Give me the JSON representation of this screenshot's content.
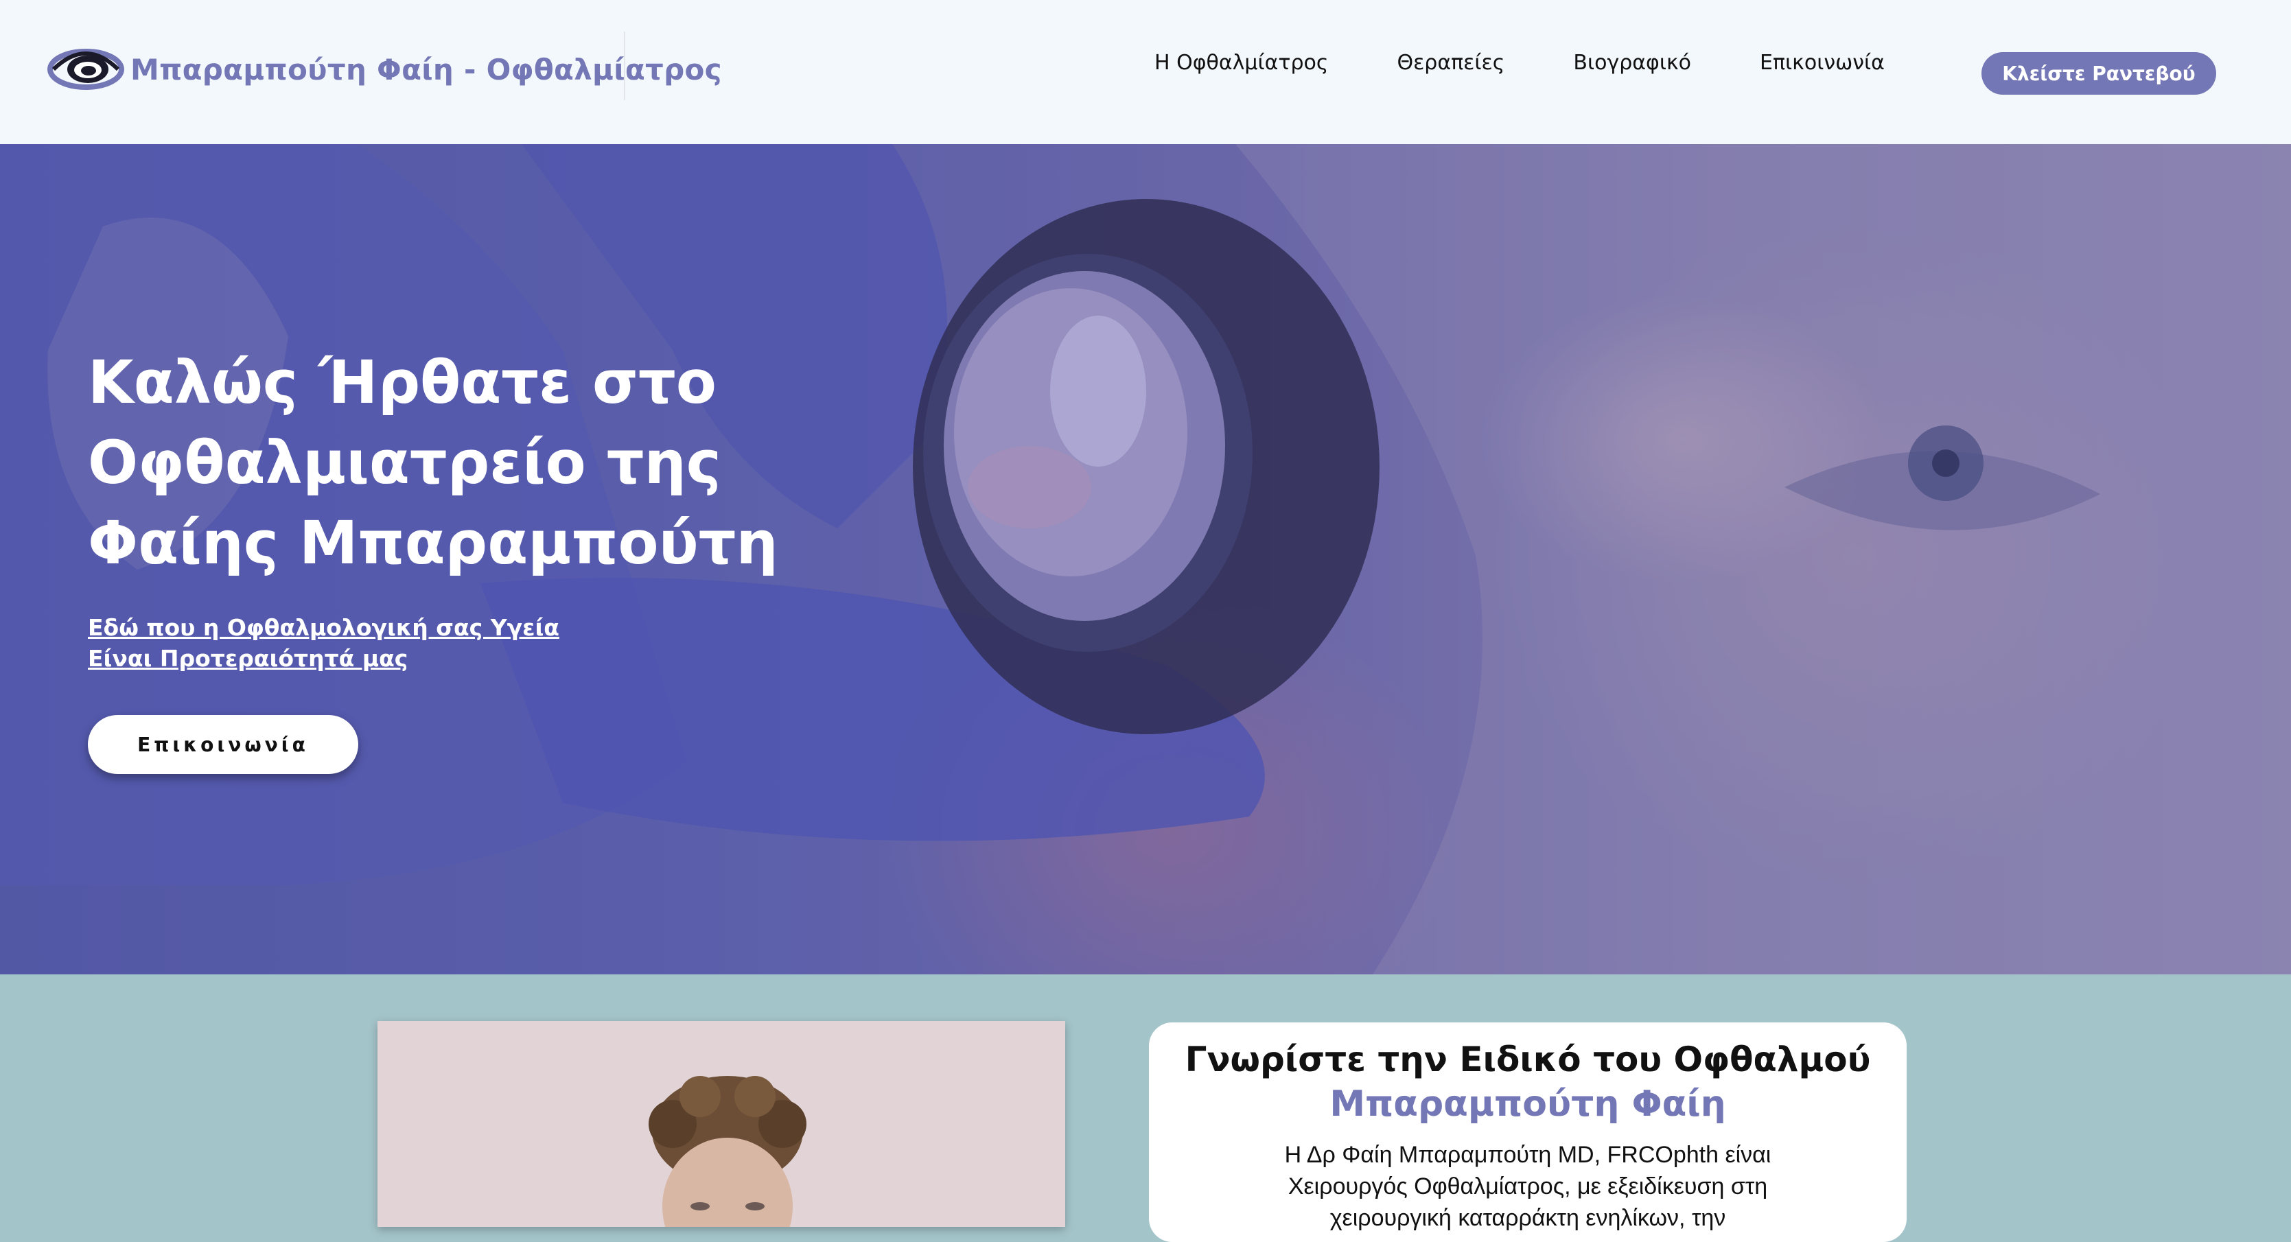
{
  "header": {
    "logo_text": "Μπαραμπούτη Φαίη - Οφθαλμίατρος",
    "nav": [
      "Η Οφθαλμίατρος",
      "Θεραπείες",
      "Βιογραφικό",
      "Επικοινωνία"
    ],
    "book_button": "Κλείστε Ραντεβού",
    "accent_color": "#7477b5"
  },
  "hero": {
    "title_lines": [
      "Καλώς Ήρθατε στο",
      "Οφθαλμιατρείο της",
      "Φαίης Μπαραμπούτη"
    ],
    "subtitle": "Εδώ που η Οφθαλμολογική σας Υγεία Είναι Προτεραιότητά μας",
    "button": "Επικοινωνία"
  },
  "about": {
    "title": "Γνωρίστε την Ειδικό του Οφθαλμού",
    "name": "Μπαραμπούτη Φαίη",
    "text": "Η Δρ Φαίη Μπαραμπούτη MD, FRCOphth είναι Χειρουργός Οφθαλμίατρος, με εξειδίκευση στη χειρουργική καταρράκτη ενηλίκων, την"
  }
}
